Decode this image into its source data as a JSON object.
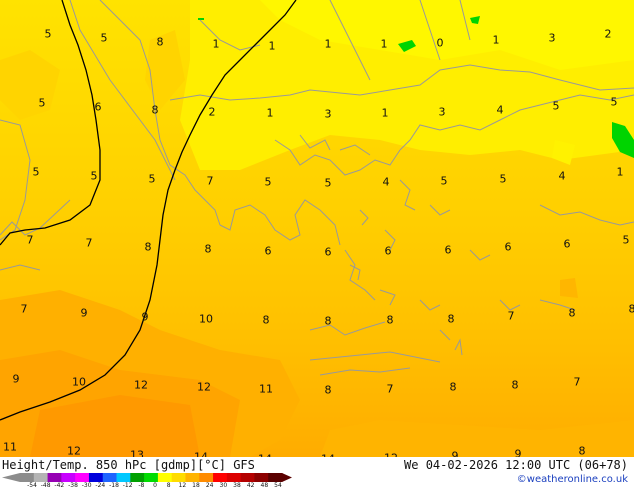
{
  "map": {
    "title": "Height/Temp. 850 hPc [gdmp][°C] GFS",
    "valid_time": "We 04-02-2026 12:00 UTC (06+78)",
    "credit": "©weatheronline.co.uk",
    "legend_ticks": [
      "-54",
      "-48",
      "-42",
      "-38",
      "-30",
      "-24",
      "-18",
      "-12",
      "-8",
      "0",
      "8",
      "12",
      "18",
      "24",
      "30",
      "38",
      "42",
      "48",
      "54"
    ],
    "legend_colors": [
      "#8c8c8c",
      "#b4b4b4",
      "#9600b4",
      "#c800ff",
      "#ff00ff",
      "#0000dc",
      "#1e64ff",
      "#00c8ff",
      "#00a000",
      "#00dc00",
      "#ffff00",
      "#ffdc00",
      "#ffb400",
      "#ff8c00",
      "#ff0000",
      "#dc0000",
      "#b40000",
      "#8c0000",
      "#5a0000"
    ],
    "temperature_labels": [
      {
        "text": "5"
      },
      {
        "text": "5"
      },
      {
        "text": "8"
      },
      {
        "text": "1"
      },
      {
        "text": "1"
      },
      {
        "text": "1"
      },
      {
        "text": "1"
      },
      {
        "text": "0"
      },
      {
        "text": "1"
      },
      {
        "text": "3"
      },
      {
        "text": "2"
      },
      {
        "text": "5"
      },
      {
        "text": "6"
      },
      {
        "text": "8"
      },
      {
        "text": "2"
      },
      {
        "text": "1"
      },
      {
        "text": "3"
      },
      {
        "text": "1"
      },
      {
        "text": "3"
      },
      {
        "text": "4"
      },
      {
        "text": "5"
      },
      {
        "text": "5"
      },
      {
        "text": "5"
      },
      {
        "text": "5"
      },
      {
        "text": "5"
      },
      {
        "text": "7"
      },
      {
        "text": "5"
      },
      {
        "text": "5"
      },
      {
        "text": "4"
      },
      {
        "text": "5"
      },
      {
        "text": "5"
      },
      {
        "text": "4"
      },
      {
        "text": "1"
      },
      {
        "text": "7"
      },
      {
        "text": "7"
      },
      {
        "text": "8"
      },
      {
        "text": "8"
      },
      {
        "text": "6"
      },
      {
        "text": "6"
      },
      {
        "text": "6"
      },
      {
        "text": "6"
      },
      {
        "text": "6"
      },
      {
        "text": "6"
      },
      {
        "text": "5"
      },
      {
        "text": "7"
      },
      {
        "text": "9"
      },
      {
        "text": "9"
      },
      {
        "text": "10"
      },
      {
        "text": "8"
      },
      {
        "text": "8"
      },
      {
        "text": "8"
      },
      {
        "text": "8"
      },
      {
        "text": "7"
      },
      {
        "text": "8"
      },
      {
        "text": "8"
      },
      {
        "text": "9"
      },
      {
        "text": "10"
      },
      {
        "text": "12"
      },
      {
        "text": "12"
      },
      {
        "text": "11"
      },
      {
        "text": "8"
      },
      {
        "text": "7"
      },
      {
        "text": "8"
      },
      {
        "text": "8"
      },
      {
        "text": "7"
      },
      {
        "text": "11"
      },
      {
        "text": "12"
      },
      {
        "text": "13"
      },
      {
        "text": "14"
      },
      {
        "text": "14"
      },
      {
        "text": "14"
      },
      {
        "text": "12"
      },
      {
        "text": "9"
      },
      {
        "text": "9"
      },
      {
        "text": "8"
      }
    ]
  }
}
